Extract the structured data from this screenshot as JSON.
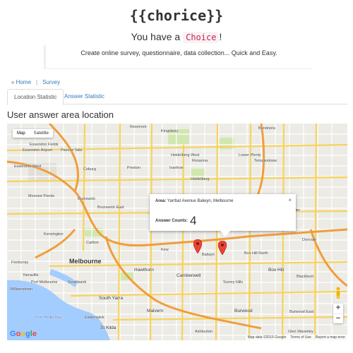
{
  "header": {
    "brand": "{{chorice}}",
    "tagline_prefix": "You have a ",
    "tagline_code": "Choice",
    "tagline_suffix": "!",
    "lead": "Create online survey, questionnaire, data collection... Quick and Easy."
  },
  "breadcrumb": {
    "home": "« Home",
    "separator": "|",
    "current": "Survey"
  },
  "tabs": [
    {
      "label": "Location Statistic",
      "active": true
    },
    {
      "label": "Answer Statistic",
      "active": false
    }
  ],
  "section_title": "User answer area location",
  "map": {
    "type_controls": [
      "Map",
      "Satellite"
    ],
    "selected_type": "Map",
    "info": {
      "area_label": "Area:",
      "area_value": "Yarrbat Avenue Balwyn, Melbourne",
      "count_label": "Answer Counts:",
      "count_value": "4",
      "close": "×"
    },
    "zoom_in": "+",
    "zoom_out": "−",
    "attribution": [
      "Map data ©2016 Google",
      "Terms of Use",
      "Report a map error"
    ],
    "labels": {
      "essendon_fields": "Essendon Fields",
      "essendon_airport": "Essendon Airport",
      "pascoe_vale": "Pascoe Vale",
      "reservoir": "Reservoir",
      "kingsbury": "Kingsbury",
      "bundoora": "Bundoora",
      "heidelberg_west": "Heidelberg West",
      "rosanna": "Rosanna",
      "lower_plenty": "Lower Plenty",
      "essendon_west": "Essendon West",
      "coburg": "Coburg",
      "preston": "Preston",
      "ivanhoe": "Ivanhoe",
      "templestowe": "Templestowe",
      "heidelberg": "Heidelberg",
      "moonee_ponds": "Moonee Ponds",
      "brunswick": "Brunswick",
      "brunswick_east": "Brunswick East",
      "doncaster": "Doncaster",
      "kensington": "Kensington",
      "carlton": "Carlton",
      "kew": "Kew",
      "balwyn": "Balwyn",
      "box_hill_north": "Box Hill North",
      "donvale": "Donvale",
      "footscray": "Footscray",
      "melbourne": "Melbourne",
      "hawthorn": "Hawthorn",
      "box_hill": "Box Hill",
      "yarraville": "Yarraville",
      "port_melbourne": "Port Melbourne",
      "southbank": "Southbank",
      "camberwell": "Camberwell",
      "surrey_hills": "Surrey Hills",
      "blackburn": "Blackburn",
      "williamstown": "Williamstown",
      "south_yarra": "South Yarra",
      "malvern": "Malvern",
      "burwood": "Burwood",
      "burwood_east": "Burwood East",
      "elsternwick": "Elsternwick",
      "st_kilda": "St Kilda",
      "ashburton": "Ashburton",
      "glen_waverley": "Glen Waverley",
      "port_phillip_bay": "Port Phillip Bay"
    }
  }
}
